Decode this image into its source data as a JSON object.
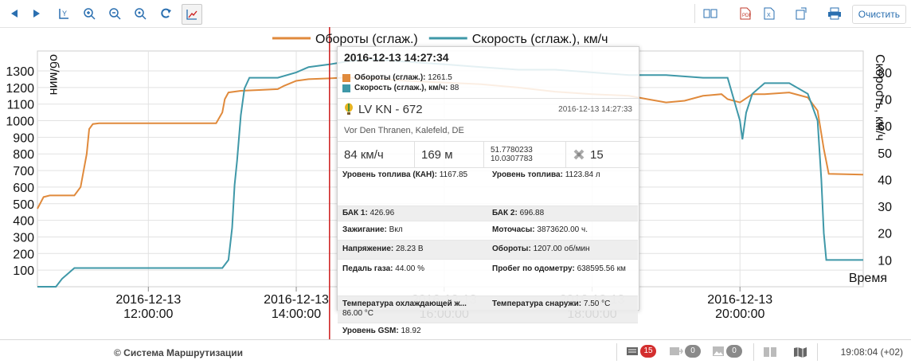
{
  "toolbar": {
    "buttons_left": [
      "prev-icon",
      "next-icon",
      "y-axis-icon",
      "zoom-in-icon",
      "zoom-out-icon",
      "zoom-fit-icon",
      "refresh-icon",
      "chart-mode-icon"
    ],
    "buttons_right": [
      "book-icon",
      "pdf-icon",
      "excel-icon",
      "export-icon",
      "print-icon"
    ],
    "clear_label": "Очистить"
  },
  "colors": {
    "rpm": "#e08a3c",
    "speed": "#3f98a8",
    "cursor": "#cc1b1b",
    "accent": "#2a6fb0",
    "badge_red": "#d32f2f",
    "badge_gray": "#8a8a8a"
  },
  "chart_data": {
    "type": "line",
    "legend": [
      {
        "name": "Обороты (сглаж.)",
        "color": "#e08a3c"
      },
      {
        "name": "Скорость (сглаж.), км/ч",
        "color": "#3f98a8"
      }
    ],
    "legend_placement": "top-center",
    "y_left": {
      "label": "об/мин",
      "ticks": [
        "100",
        "200",
        "300",
        "400",
        "500",
        "600",
        "700",
        "800",
        "900",
        "1000",
        "1100",
        "1200",
        "1300"
      ],
      "range": [
        0,
        1420
      ]
    },
    "y_right": {
      "label": "Скорость, км/ч",
      "ticks": [
        "10",
        "20",
        "30",
        "40",
        "50",
        "60",
        "70",
        "80"
      ],
      "range": [
        0,
        88
      ]
    },
    "x_axis": {
      "label": "Время",
      "ticks": [
        [
          "2016-12-13",
          "12:00:00"
        ],
        [
          "2016-12-13",
          "14:00:00"
        ],
        [
          "2016-12-13",
          "16:00:00"
        ],
        [
          "2016-12-13",
          "18:00:00"
        ],
        [
          "2016-12-13",
          "20:00:00"
        ]
      ],
      "range": [
        "2016-12-13 10:30",
        "2016-12-13 21:40"
      ]
    },
    "grid": true,
    "cursor_time": "2016-12-13 14:27:34",
    "series": [
      {
        "name": "Обороты (сглаж.)",
        "axis": "left",
        "points": [
          [
            "10:30",
            470
          ],
          [
            "10:35",
            540
          ],
          [
            "10:40",
            550
          ],
          [
            "11:00",
            550
          ],
          [
            "11:05",
            600
          ],
          [
            "11:10",
            800
          ],
          [
            "11:12",
            950
          ],
          [
            "11:15",
            980
          ],
          [
            "11:20",
            985
          ],
          [
            "11:40",
            985
          ],
          [
            "12:00",
            985
          ],
          [
            "12:20",
            985
          ],
          [
            "12:40",
            985
          ],
          [
            "12:55",
            985
          ],
          [
            "13:00",
            1050
          ],
          [
            "13:02",
            1130
          ],
          [
            "13:05",
            1170
          ],
          [
            "13:15",
            1180
          ],
          [
            "13:30",
            1185
          ],
          [
            "13:45",
            1190
          ],
          [
            "13:50",
            1210
          ],
          [
            "14:00",
            1240
          ],
          [
            "14:10",
            1250
          ],
          [
            "14:27",
            1255
          ],
          [
            "14:40",
            1260
          ],
          [
            "15:00",
            1255
          ],
          [
            "15:30",
            1240
          ],
          [
            "16:00",
            1230
          ],
          [
            "16:30",
            1220
          ],
          [
            "17:00",
            1200
          ],
          [
            "17:30",
            1175
          ],
          [
            "18:00",
            1160
          ],
          [
            "18:30",
            1150
          ],
          [
            "18:45",
            1130
          ],
          [
            "19:00",
            1110
          ],
          [
            "19:15",
            1120
          ],
          [
            "19:30",
            1150
          ],
          [
            "19:45",
            1160
          ],
          [
            "19:50",
            1130
          ],
          [
            "20:00",
            1110
          ],
          [
            "20:10",
            1160
          ],
          [
            "20:20",
            1160
          ],
          [
            "20:40",
            1170
          ],
          [
            "20:55",
            1140
          ],
          [
            "21:03",
            1060
          ],
          [
            "21:08",
            830
          ],
          [
            "21:12",
            680
          ],
          [
            "21:40",
            675
          ]
        ]
      },
      {
        "name": "Скорость (сглаж.), км/ч",
        "axis": "right",
        "points": [
          [
            "10:30",
            0
          ],
          [
            "10:45",
            0
          ],
          [
            "10:50",
            3
          ],
          [
            "10:55",
            5
          ],
          [
            "11:00",
            7
          ],
          [
            "11:15",
            7
          ],
          [
            "12:00",
            7
          ],
          [
            "12:30",
            7
          ],
          [
            "12:50",
            7
          ],
          [
            "13:00",
            7
          ],
          [
            "13:05",
            10
          ],
          [
            "13:08",
            22
          ],
          [
            "13:10",
            38
          ],
          [
            "13:12",
            47
          ],
          [
            "13:15",
            64
          ],
          [
            "13:18",
            74
          ],
          [
            "13:22",
            78
          ],
          [
            "13:30",
            78
          ],
          [
            "13:45",
            78
          ],
          [
            "14:00",
            80
          ],
          [
            "14:10",
            82
          ],
          [
            "14:27",
            83
          ],
          [
            "14:40",
            84
          ],
          [
            "15:00",
            85
          ],
          [
            "15:30",
            84
          ],
          [
            "16:00",
            83
          ],
          [
            "16:30",
            82
          ],
          [
            "17:00",
            81
          ],
          [
            "17:30",
            81
          ],
          [
            "18:00",
            80
          ],
          [
            "18:30",
            79
          ],
          [
            "19:00",
            79
          ],
          [
            "19:30",
            78
          ],
          [
            "19:50",
            78
          ],
          [
            "20:00",
            62
          ],
          [
            "20:02",
            55
          ],
          [
            "20:05",
            65
          ],
          [
            "20:10",
            72
          ],
          [
            "20:20",
            76
          ],
          [
            "20:40",
            76
          ],
          [
            "20:55",
            72
          ],
          [
            "21:03",
            62
          ],
          [
            "21:06",
            40
          ],
          [
            "21:08",
            20
          ],
          [
            "21:10",
            10
          ],
          [
            "21:40",
            10
          ]
        ]
      }
    ]
  },
  "tooltip": {
    "header": "2016-12-13 14:27:34",
    "rows": [
      {
        "label": "Обороты (сглаж.):",
        "value": "1261.5"
      },
      {
        "label": "Скорость (сглаж.), км/ч:",
        "value": "88"
      }
    ],
    "unit_name": "LV KN - 672",
    "unit_time": "2016-12-13 14:27:33",
    "address": "Vor Den Thranen, Kalefeld, DE",
    "speed": "84 км/ч",
    "altitude": "169 м",
    "lat": "51.7780233",
    "lon": "10.0307783",
    "satellites": "15",
    "params": [
      {
        "label": "Уровень топлива (КАН):",
        "value": "1167.85"
      },
      {
        "label": "Уровень топлива:",
        "value": "1123.84 л"
      },
      {
        "label": "БАК 1:",
        "value": "426.96"
      },
      {
        "label": "БАК 2:",
        "value": "696.88"
      },
      {
        "label": "Зажигание:",
        "value": "Вкл"
      },
      {
        "label": "Моточасы:",
        "value": "3873620.00 ч."
      },
      {
        "label": "Напряжение:",
        "value": "28.23 В"
      },
      {
        "label": "Обороты:",
        "value": "1207.00 об/мин"
      },
      {
        "label": "Педаль газа:",
        "value": "44.00 %"
      },
      {
        "label": "Пробег по одометру:",
        "value": "638595.56 км"
      },
      {
        "label": "Температура охлаждающей ж...",
        "value": "86.00 °C"
      },
      {
        "label": "Температура снаружи:",
        "value": "7.50 °C"
      },
      {
        "label": "Уровень GSM:",
        "value": "18.92"
      }
    ]
  },
  "footer": {
    "copyright": "© Система Маршрутизации",
    "messages_count": "15",
    "sent_count": "0",
    "images_count": "0",
    "time": "19:08:04 (+02)"
  }
}
